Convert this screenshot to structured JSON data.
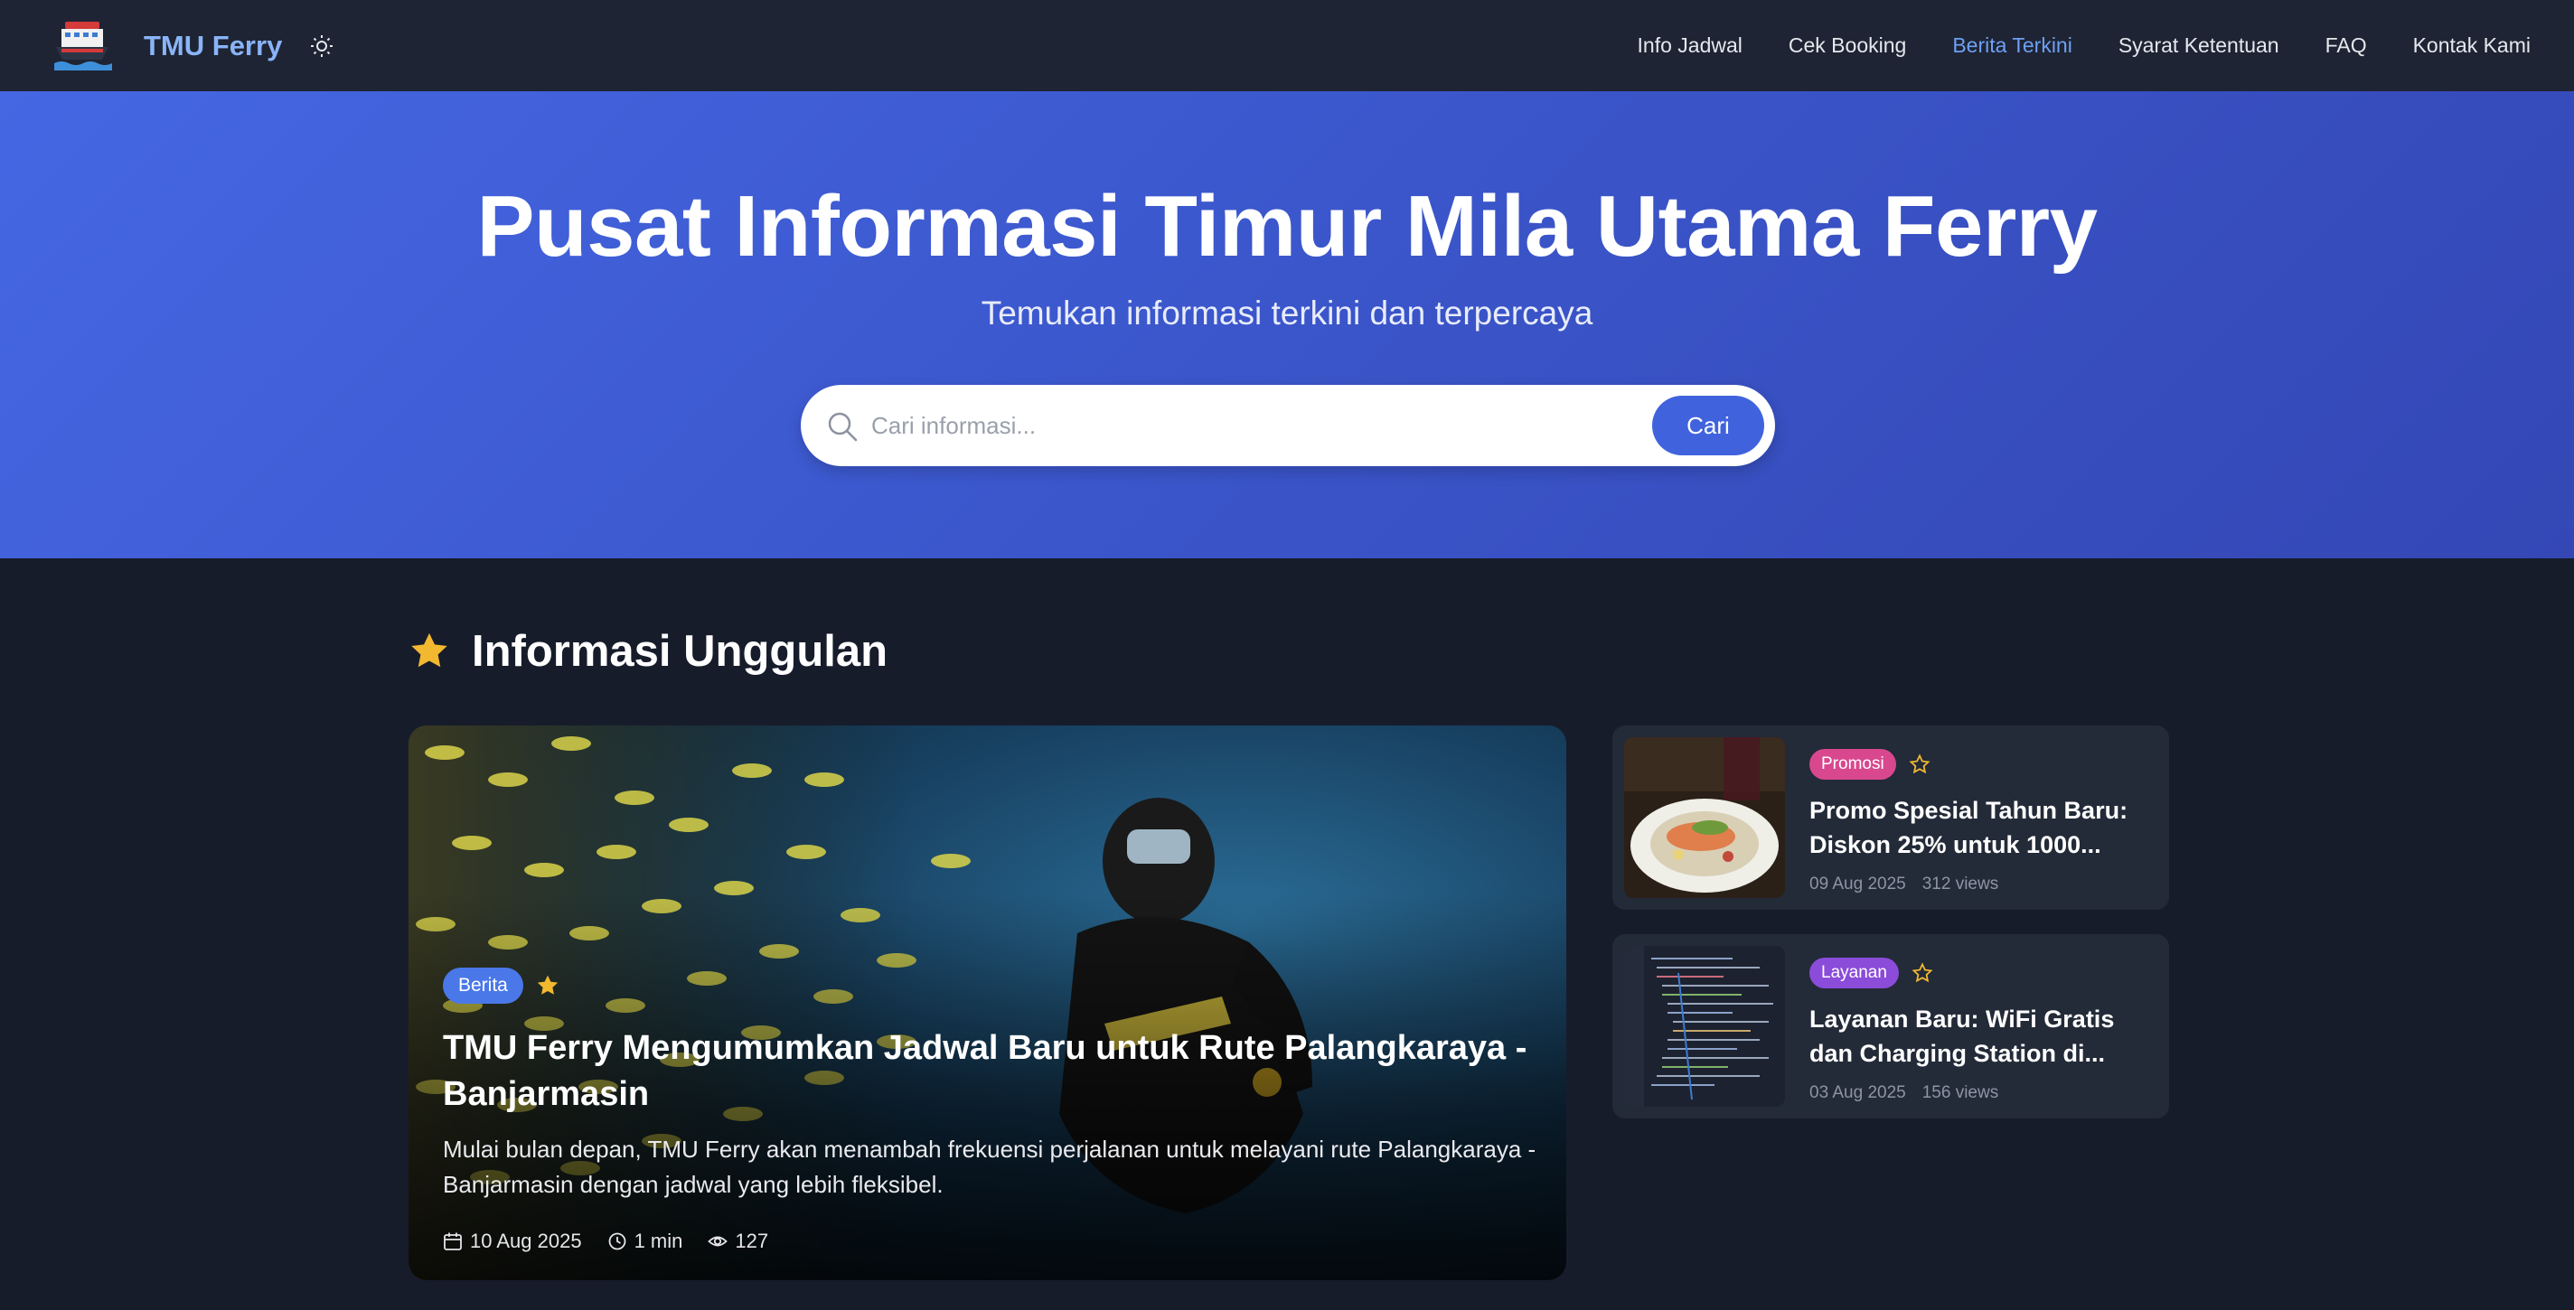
{
  "nav": {
    "brand": "TMU Ferry",
    "links": [
      {
        "label": "Info Jadwal",
        "active": false
      },
      {
        "label": "Cek Booking",
        "active": false
      },
      {
        "label": "Berita Terkini",
        "active": true
      },
      {
        "label": "Syarat Ketentuan",
        "active": false
      },
      {
        "label": "FAQ",
        "active": false
      },
      {
        "label": "Kontak Kami",
        "active": false
      }
    ],
    "theme_icon": "sun-icon"
  },
  "hero": {
    "title": "Pusat Informasi Timur Mila Utama Ferry",
    "subtitle": "Temukan informasi terkini dan terpercaya",
    "search_placeholder": "Cari informasi...",
    "search_value": "",
    "search_button": "Cari"
  },
  "section": {
    "title": "Informasi Unggulan",
    "icon": "star-icon"
  },
  "featured": {
    "category": "Berita",
    "title": "TMU Ferry Mengumumkan Jadwal Baru untuk Rute Palangkaraya - Banjarmasin",
    "excerpt": "Mulai bulan depan, TMU Ferry akan menambah frekuensi perjalanan untuk melayani rute Palangkaraya - Banjarmasin dengan jadwal yang lebih fleksibel.",
    "date": "10 Aug 2025",
    "read_time": "1 min",
    "views": "127"
  },
  "side_items": [
    {
      "category": "Promosi",
      "title": "Promo Spesial Tahun Baru: Diskon 25% untuk 1000...",
      "date": "09 Aug 2025",
      "views": "312 views"
    },
    {
      "category": "Layanan",
      "title": "Layanan Baru: WiFi Gratis dan Charging Station di...",
      "date": "03 Aug 2025",
      "views": "156 views"
    }
  ],
  "colors": {
    "nav_bg": "#1e2433",
    "hero_gradient_start": "#4567e3",
    "hero_gradient_end": "#3447b5",
    "page_bg": "#171c2b",
    "accent": "#4063dd",
    "star": "#f2b930",
    "badge_berita": "#4a78e8",
    "badge_promosi": "#d9488f",
    "badge_layanan": "#8a4cd9"
  }
}
